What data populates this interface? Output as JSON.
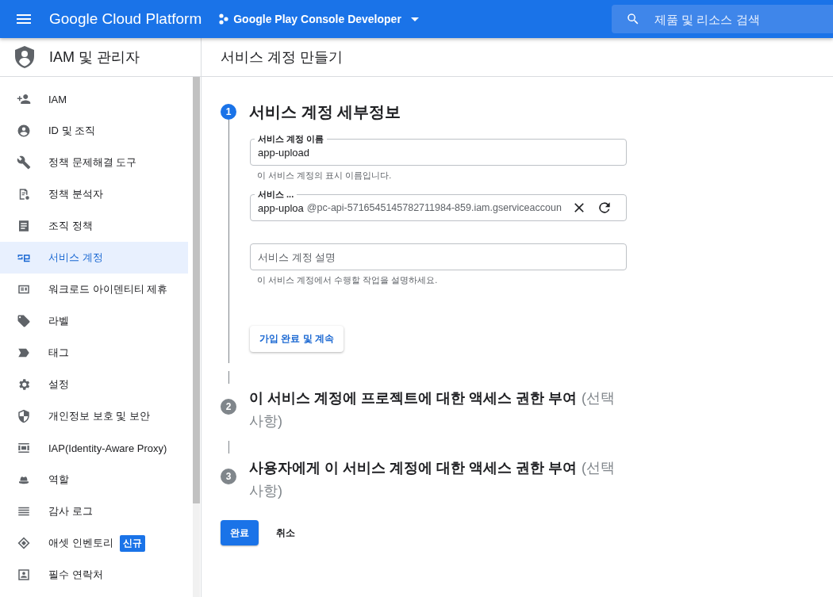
{
  "top_bar": {
    "product": "Google Cloud Platform",
    "project": "Google Play Console Developer",
    "search": {
      "placeholder": "제품 및 리소스 검색"
    }
  },
  "sidebar": {
    "title": "IAM 및 관리자",
    "items": [
      {
        "label": "IAM",
        "selected": false
      },
      {
        "label": "ID 및 조직",
        "selected": false
      },
      {
        "label": "정책 문제해결 도구",
        "selected": false
      },
      {
        "label": "정책 분석자",
        "selected": false
      },
      {
        "label": "조직 정책",
        "selected": false
      },
      {
        "label": "서비스 계정",
        "selected": true
      },
      {
        "label": "워크로드 아이덴티티 제휴",
        "selected": false
      },
      {
        "label": "라벨",
        "selected": false
      },
      {
        "label": "태그",
        "selected": false
      },
      {
        "label": "설정",
        "selected": false
      },
      {
        "label": "개인정보 보호 및 보안",
        "selected": false
      },
      {
        "label": "IAP(Identity-Aware Proxy)",
        "selected": false
      },
      {
        "label": "역할",
        "selected": false
      },
      {
        "label": "감사 로그",
        "selected": false
      },
      {
        "label": "애셋 인벤토리",
        "selected": false,
        "badge": "신규"
      },
      {
        "label": "필수 연락처",
        "selected": false
      }
    ]
  },
  "page_title": "서비스 계정 만들기",
  "steps": [
    {
      "number": "1",
      "title": "서비스 계정 세부정보",
      "active": true,
      "fields": [
        {
          "label": "서비스 계정 이름",
          "value": "app-upload",
          "hint": "이 서비스 계정의 표시 이름입니다."
        },
        {
          "label": "서비스 ...",
          "value": "app-uploa",
          "suffix": "@pc-api-5716545145782711984-859.iam.gserviceaccoun"
        },
        {
          "placeholder": "서비스 계정 설명",
          "hint": "이 서비스 계정에서 수행할 작업을 설명하세요."
        }
      ],
      "continue_button": "가입 완료 및 계속"
    },
    {
      "number": "2",
      "title": "이 서비스 계정에 프로젝트에 대한 액세스 권한 부여",
      "optional": "(선택사항)",
      "active": false
    },
    {
      "number": "3",
      "title": "사용자에게 이 서비스 계정에 대한 액세스 권한 부여",
      "optional": "(선택사항)",
      "active": false
    }
  ],
  "actions": {
    "done": "완료",
    "cancel": "취소"
  }
}
